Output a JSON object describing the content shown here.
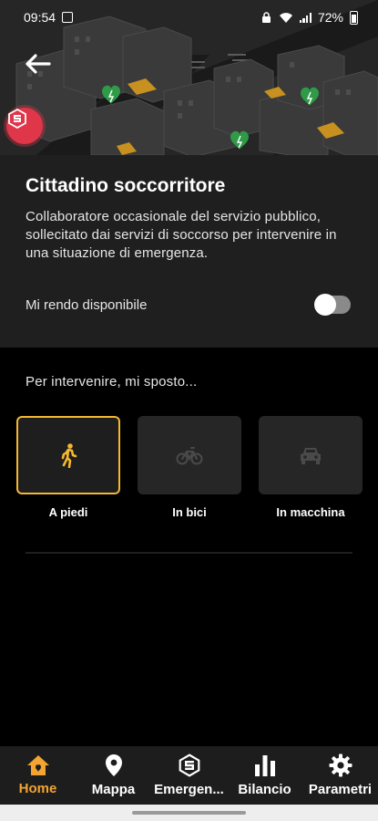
{
  "status_bar": {
    "time": "09:54",
    "battery": "72%"
  },
  "header": {
    "back_icon": "arrow-left-icon",
    "badge_icon": "s-logo-icon"
  },
  "info": {
    "title": "Cittadino soccorritore",
    "description": "Collaboratore occasionale del servizio pubblico, sollecitato dai servizi di soccorso per intervenire in una situazione di emergenza.",
    "availability_label": "Mi rendo disponibile",
    "availability_enabled": false
  },
  "transport": {
    "prompt": "Per intervenire, mi sposto...",
    "options": [
      {
        "label": "A piedi",
        "icon": "walk-icon",
        "selected": true
      },
      {
        "label": "In bici",
        "icon": "bike-icon",
        "selected": false
      },
      {
        "label": "In macchina",
        "icon": "car-icon",
        "selected": false
      }
    ]
  },
  "nav": {
    "items": [
      {
        "label": "Home",
        "icon": "home-icon",
        "active": true
      },
      {
        "label": "Mappa",
        "icon": "map-pin-icon",
        "active": false
      },
      {
        "label": "Emergen...",
        "icon": "emergency-logo-icon",
        "active": false
      },
      {
        "label": "Bilancio",
        "icon": "bar-chart-icon",
        "active": false
      },
      {
        "label": "Parametri",
        "icon": "gear-icon",
        "active": false
      }
    ]
  },
  "colors": {
    "accent": "#f4b731",
    "nav_active": "#f4a531",
    "badge": "#e0364a",
    "heart": "#2f9a47"
  }
}
